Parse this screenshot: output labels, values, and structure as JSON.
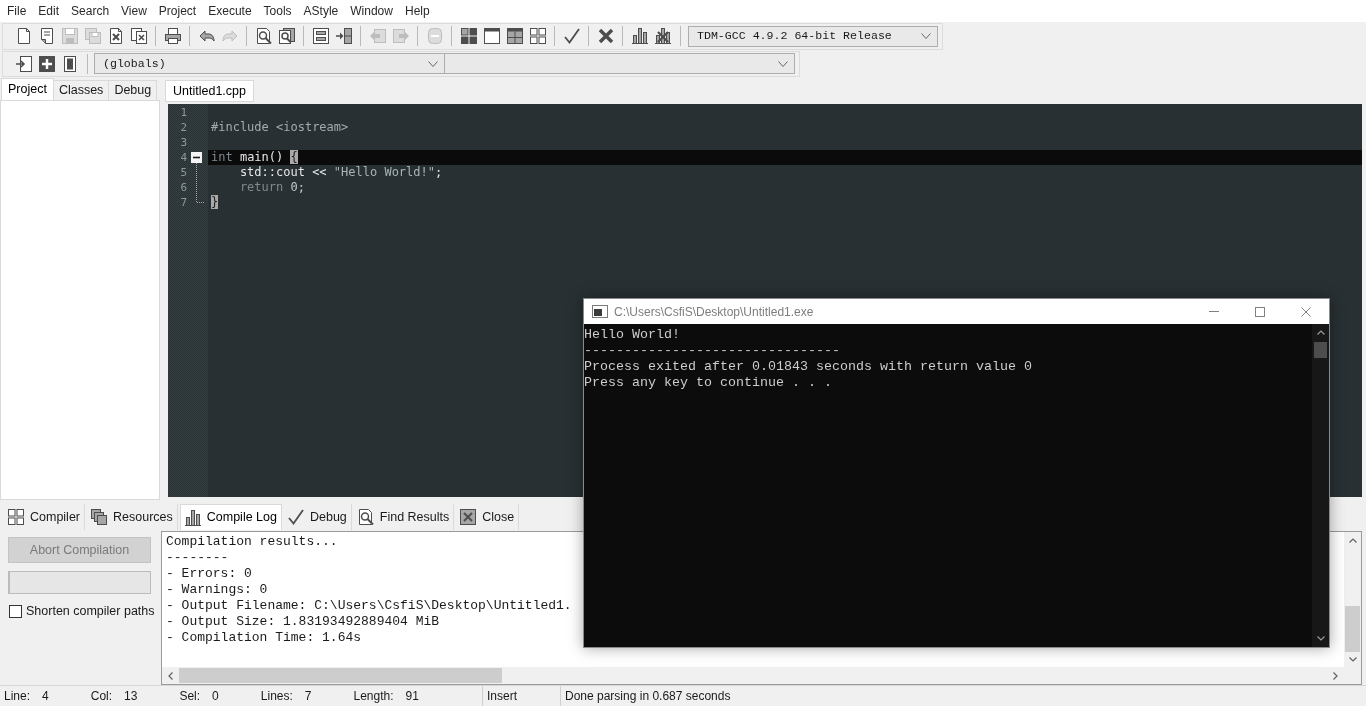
{
  "menu_bar": [
    "File",
    "Edit",
    "Search",
    "View",
    "Project",
    "Execute",
    "Tools",
    "AStyle",
    "Window",
    "Help"
  ],
  "main_toolbar": {
    "groups": [
      [
        {
          "disabled": false
        },
        {
          "disabled": false
        },
        {
          "disabled": true
        },
        {
          "disabled": true
        },
        {
          "disabled": false
        },
        {
          "disabled": false
        }
      ],
      [
        {
          "disabled": false
        }
      ],
      [
        {
          "disabled": false
        },
        {
          "disabled": true
        }
      ],
      [
        {
          "disabled": false
        },
        {
          "disabled": false
        }
      ],
      [
        {
          "disabled": false
        },
        {
          "disabled": false
        }
      ],
      [
        {
          "disabled": true
        },
        {
          "disabled": true
        }
      ],
      [
        {
          "disabled": true
        }
      ],
      [
        {
          "disabled": false
        },
        {
          "disabled": false
        },
        {
          "disabled": false
        },
        {
          "disabled": false
        }
      ],
      [
        {
          "disabled": false
        }
      ],
      [
        {
          "disabled": false
        }
      ],
      [
        {
          "disabled": false
        },
        {
          "disabled": false
        }
      ]
    ],
    "compiler_select": "TDM-GCC 4.9.2 64-bit Release"
  },
  "class_toolbar": {
    "groups": [
      [
        {
          "disabled": false
        },
        {
          "disabled": false
        },
        {
          "disabled": false
        }
      ]
    ],
    "scope_select": "(globals)"
  },
  "side_panel": {
    "tabs": [
      {
        "label": "Project",
        "selected": true
      },
      {
        "label": "Classes",
        "selected": false
      },
      {
        "label": "Debug",
        "selected": false
      }
    ]
  },
  "editor": {
    "tabs": [
      {
        "label": "Untitled1.cpp",
        "selected": true
      }
    ],
    "lines": [
      {
        "number": "1",
        "current": false
      },
      {
        "number": "2",
        "current": false,
        "tokens": [
          {
            "text": "#include <iostream>",
            "kind": "preprocessor"
          }
        ]
      },
      {
        "number": "3",
        "current": false
      },
      {
        "number": "4",
        "current": true,
        "expanded": true,
        "tokens": [
          {
            "text": "int",
            "kind": "keyword"
          },
          {
            "text": " main() ",
            "kind": "plain"
          },
          {
            "text": "{",
            "kind": "brace_match"
          }
        ],
        "children": [
          {
            "number": "5",
            "current": false,
            "tokens": [
              {
                "text": "    std::cout << ",
                "kind": "plain"
              },
              {
                "text": "\"Hello World!\"",
                "kind": "string"
              },
              {
                "text": ";",
                "kind": "plain"
              }
            ]
          },
          {
            "number": "6",
            "current": false,
            "tokens": [
              {
                "text": "    return",
                "kind": "keyword"
              },
              {
                "text": " 0;",
                "kind": "number"
              }
            ]
          },
          {
            "number": "7",
            "current": false,
            "tokens": [
              {
                "text": "}",
                "kind": "brace_match"
              }
            ]
          }
        ]
      }
    ]
  },
  "bottom_panel": {
    "tabs": [
      {
        "label": "Compiler",
        "selected": false
      },
      {
        "label": "Resources",
        "selected": false
      },
      {
        "label": "Compile Log",
        "selected": true
      },
      {
        "label": "Debug",
        "selected": false
      },
      {
        "label": "Find Results",
        "selected": false
      },
      {
        "label": "Close",
        "selected": false
      }
    ],
    "abort_button": {
      "label": "Abort Compilation",
      "disabled": true
    },
    "progress_bar": {
      "level": 0
    },
    "shorten_paths": {
      "label": "Shorten compiler paths",
      "checked": false
    },
    "log": [
      "Compilation results...",
      "--------",
      "- Errors: 0",
      "- Warnings: 0",
      "- Output Filename: C:\\Users\\CsfiS\\Desktop\\Untitled1.",
      "- Output Size: 1.83193492889404 MiB",
      "- Compilation Time: 1.64s"
    ]
  },
  "status_bar": {
    "fields": [
      {
        "label": "Line:",
        "value": "4"
      },
      {
        "label": "Col:",
        "value": "13"
      },
      {
        "label": "Sel:",
        "value": "0"
      },
      {
        "label": "Lines:",
        "value": "7"
      },
      {
        "label": "Length:",
        "value": "91"
      }
    ],
    "mode": "Insert",
    "message": "Done parsing in 0.687 seconds"
  },
  "console": {
    "title": "C:\\Users\\CsfiS\\Desktop\\Untitled1.exe",
    "lines": [
      "Hello World!",
      "--------------------------------",
      "Process exited after 0.01843 seconds with return value 0",
      "Press any key to continue . . ."
    ]
  }
}
